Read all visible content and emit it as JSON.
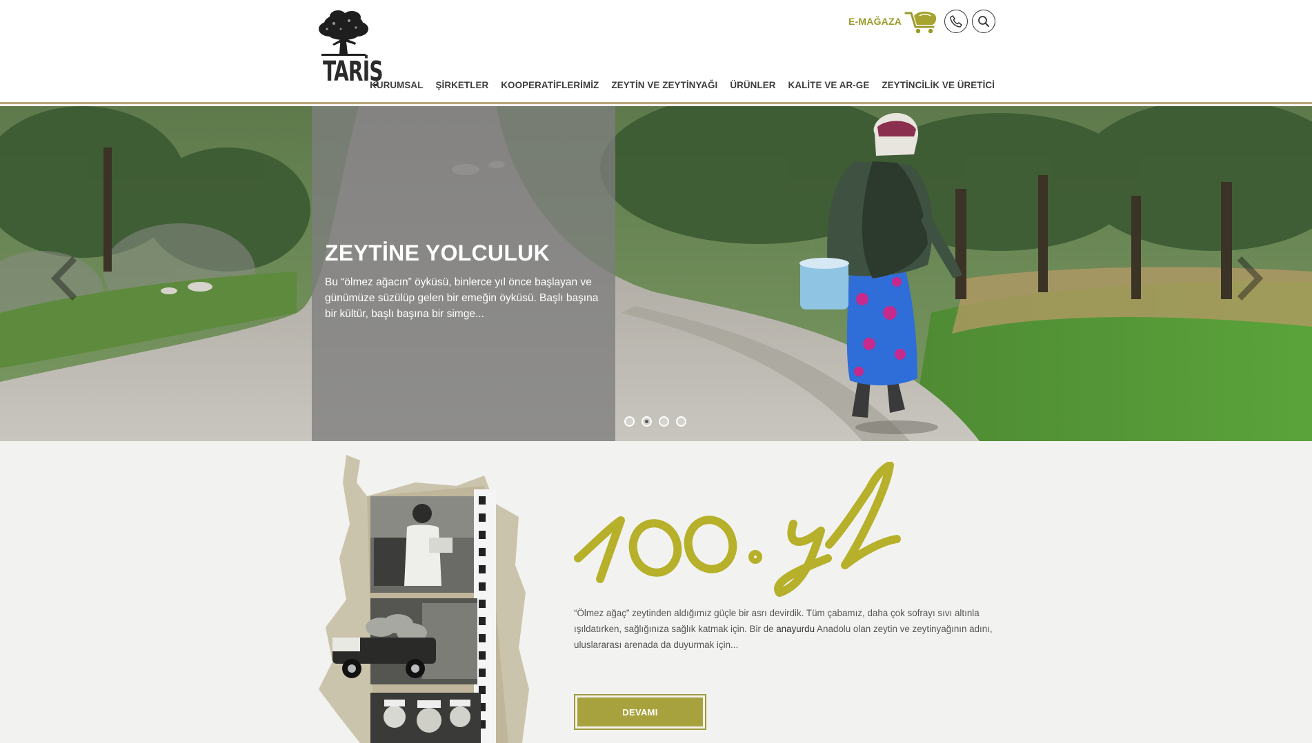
{
  "brand": {
    "name": "TARİŞ"
  },
  "header": {
    "emagaza_label": "E-MAĞAZA",
    "icons": {
      "cart": "cart-icon",
      "phone": "phone-icon",
      "search": "search-icon"
    },
    "accent_color": "#9a9a2a"
  },
  "nav": {
    "items": [
      {
        "label": "KURUMSAL"
      },
      {
        "label": "ŞİRKETLER"
      },
      {
        "label": "KOOPERATİFLERİMİZ"
      },
      {
        "label": "ZEYTİN VE ZEYTİNYAĞI"
      },
      {
        "label": "ÜRÜNLER"
      },
      {
        "label": "KALİTE VE AR-GE"
      },
      {
        "label": "ZEYTİNCİLİK VE ÜRETİCİ"
      }
    ]
  },
  "hero": {
    "title": "ZEYTİNE YOLCULUK",
    "text": "Bu “ölmez ağacın” öyküsü, binlerce yıl önce başlayan ve günümüze süzülüp gelen bir emeğin öyküsü. Başlı başına bir kültür, başlı başına bir simge...",
    "slide_count": 4,
    "active_slide": 2
  },
  "section": {
    "script_title": "100. yıl",
    "text_part1": "“Ölmez ağaç” zeytinden aldığımız güçle bir asrı devirdik. Tüm çabamız, daha çok sofrayı sıvı altınla ışıldatırken, sağlığınıza sağlık katmak için. Bir de ",
    "text_bold": "anayurdu",
    "text_part2": " Anadolu olan zeytin ve zeytinyağının adını, uluslararası arenada da duyurmak için...",
    "button_label": "DEVAMI",
    "button_color": "#a8a23e"
  }
}
